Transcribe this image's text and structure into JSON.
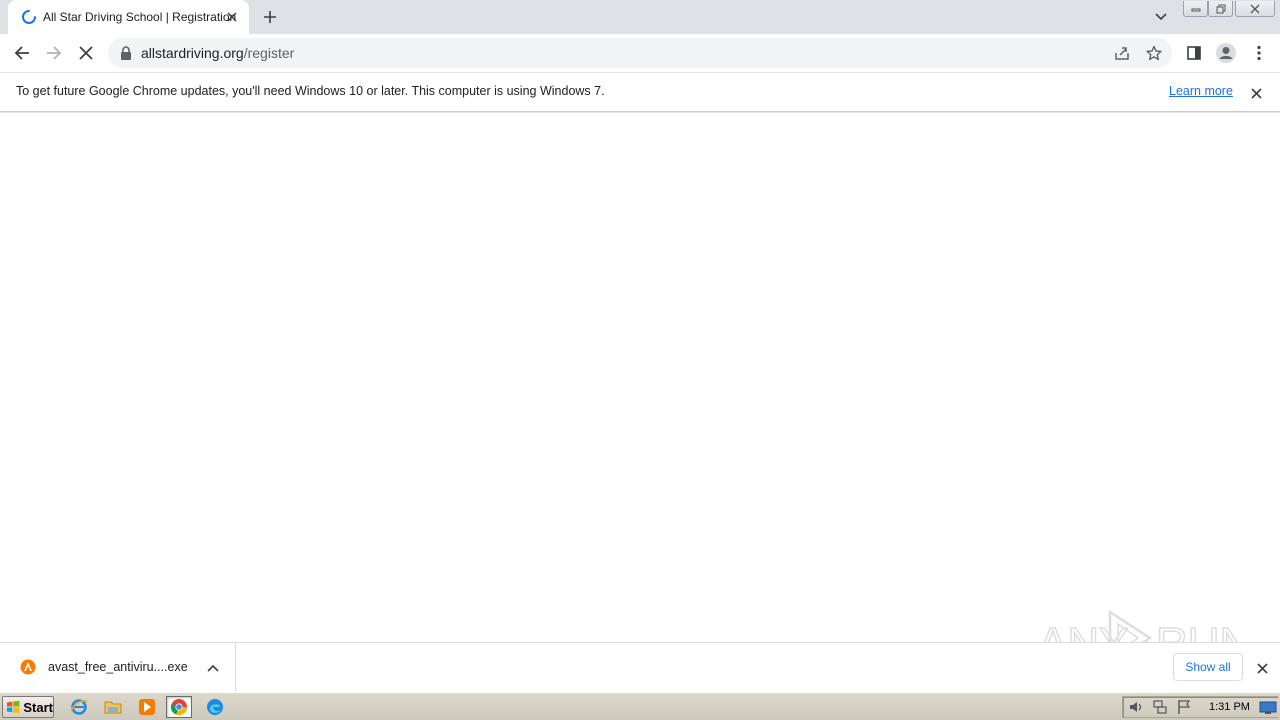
{
  "browser": {
    "tab": {
      "title": "All Star Driving School | Registration"
    },
    "address_bar": {
      "host": "allstardriving.org",
      "path": "/register"
    }
  },
  "infobar": {
    "message": "To get future Google Chrome updates, you'll need Windows 10 or later. This computer is using Windows 7.",
    "link_label": "Learn more"
  },
  "downloads": {
    "file_name": "avast_free_antiviru....exe",
    "show_all_label": "Show all"
  },
  "watermark": {
    "text_left": "ANY",
    "text_right": "RUN"
  },
  "taskbar": {
    "start_label": "Start",
    "clock": "1:31 PM"
  },
  "colors": {
    "accent": "#1a73e8",
    "tabstrip": "#dee1e6",
    "omnibox": "#f1f3f4",
    "taskbar": "#d4d0c8"
  },
  "icons": [
    "loading-spinner-icon",
    "close-icon",
    "plus-icon",
    "chevron-down-icon",
    "back-arrow-icon",
    "forward-arrow-icon",
    "stop-icon",
    "lock-icon",
    "share-icon",
    "star-icon",
    "side-panel-icon",
    "profile-icon",
    "kebab-menu-icon",
    "avast-icon",
    "chevron-up-icon",
    "windows-flag-icon",
    "internet-explorer-icon",
    "folder-icon",
    "media-player-icon",
    "chrome-icon",
    "edge-icon",
    "speaker-icon",
    "network-icon",
    "action-center-flag-icon"
  ]
}
